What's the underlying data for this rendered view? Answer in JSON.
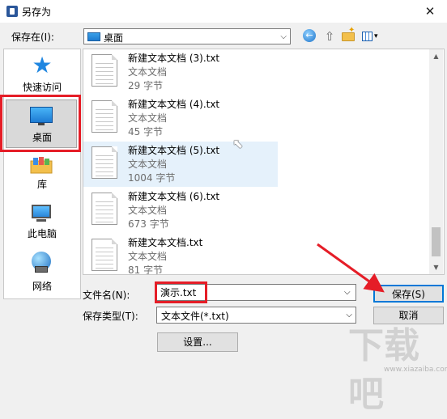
{
  "window": {
    "title": "另存为",
    "close_glyph": "✕"
  },
  "location_row": {
    "label": "保存在(I):",
    "current": "桌面",
    "dropdown_glyph": "⌵"
  },
  "toolbar": {
    "back_glyph": "←",
    "up_glyph": "⇧",
    "views_arrow": "▾"
  },
  "places": [
    {
      "label": "快速访问"
    },
    {
      "label": "桌面"
    },
    {
      "label": "库"
    },
    {
      "label": "此电脑"
    },
    {
      "label": "网络"
    }
  ],
  "files": [
    {
      "name": "新建文本文档 (3).txt",
      "type": "文本文档",
      "size": "29 字节"
    },
    {
      "name": "新建文本文档 (4).txt",
      "type": "文本文档",
      "size": "45 字节"
    },
    {
      "name": "新建文本文档 (5).txt",
      "type": "文本文档",
      "size": "1004 字节"
    },
    {
      "name": "新建文本文档 (6).txt",
      "type": "文本文档",
      "size": "673 字节"
    },
    {
      "name": "新建文本文档.txt",
      "type": "文本文档",
      "size": "81 字节"
    }
  ],
  "form": {
    "filename_label": "文件名(N):",
    "filename_value": "演示.txt",
    "filetype_label": "保存类型(T):",
    "filetype_value": "文本文件(*.txt)",
    "save_button": "保存(S)",
    "cancel_button": "取消",
    "settings_button": "设置..."
  },
  "watermark": {
    "text": "下载吧",
    "url": "www.xiazaiba.com"
  },
  "colors": {
    "highlight": "#e51d27",
    "selection": "#e5f1fb",
    "accent": "#0078d7"
  }
}
